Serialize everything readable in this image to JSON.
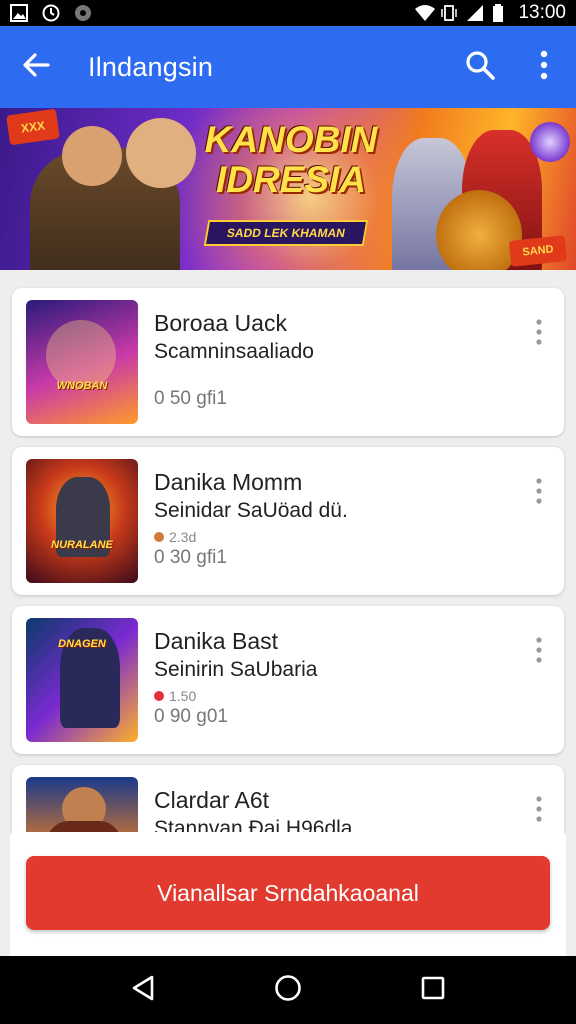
{
  "status_bar": {
    "time": "13:00",
    "icons": [
      "image-icon",
      "clock-icon",
      "notification-icon",
      "wifi-icon",
      "vibrate-icon",
      "signal-icon",
      "battery-icon"
    ]
  },
  "app_bar": {
    "title": "Ilndangsin",
    "color": "#2d6cf0",
    "icons": [
      "back-arrow-icon",
      "search-icon",
      "more-vert-icon"
    ]
  },
  "banner": {
    "title": "KANOBIN IDRESIA",
    "tagline": "SADD LEK KHAMAN",
    "badge_left": "XXX",
    "badge_right": "SAND"
  },
  "items": [
    {
      "title": "Boroaa Uack",
      "subtitle": "Scamninsaaliado",
      "meta": "",
      "meta_color": "",
      "stats": "0 50 gfi1",
      "thumb_label": "WNOBAN",
      "thumb_colors": [
        "#2a1a7a",
        "#c83aa8",
        "#ff9a2a"
      ]
    },
    {
      "title": "Danika Momm",
      "subtitle": "Seinidar SaUöad dü.",
      "meta": "2.3d",
      "meta_color": "#d4783a",
      "stats": "0 30 gfi1",
      "thumb_label": "NURALANE",
      "thumb_colors": [
        "#3a0a1a",
        "#c83a1a",
        "#ffb02a"
      ]
    },
    {
      "title": "Danika Bast",
      "subtitle": "Seinirin  SaUbaria",
      "meta": "1.50",
      "meta_color": "#e0303a",
      "stats": "0 90 g01",
      "thumb_label": "DNAGEN",
      "thumb_colors": [
        "#0a3a6a",
        "#7a2ad0",
        "#ffb02a"
      ]
    },
    {
      "title": "Clardar A6t",
      "subtitle": "Stannvan Ðai H96dla",
      "meta": "",
      "meta_color": "",
      "stats": "",
      "thumb_label": "",
      "thumb_colors": [
        "#1a3a8a",
        "#e07a2a",
        "#ffd04a"
      ]
    }
  ],
  "cta": {
    "label": "Vianallsar Srndahkaoanal",
    "color": "#e23a2e"
  },
  "nav_bar": {
    "icons": [
      "back-triangle-icon",
      "home-circle-icon",
      "recents-square-icon"
    ]
  }
}
